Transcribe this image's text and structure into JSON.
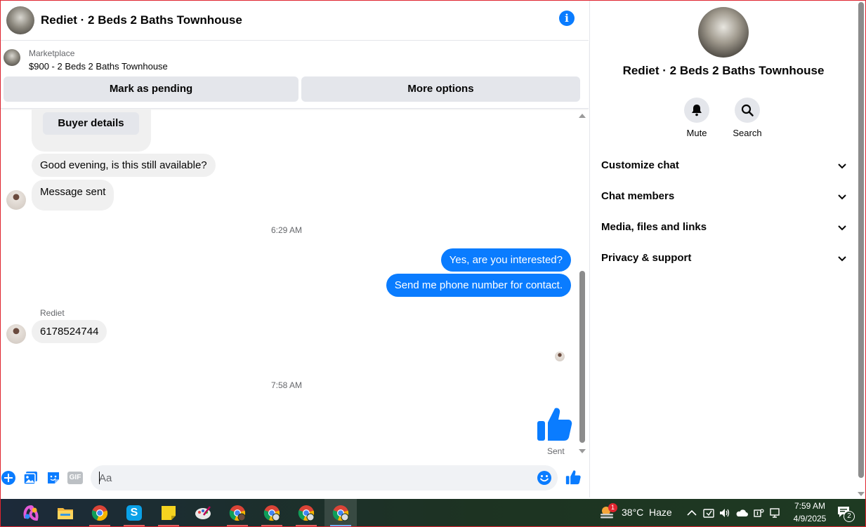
{
  "header": {
    "title": "Rediet · 2 Beds 2 Baths Townhouse"
  },
  "marketplace": {
    "label": "Marketplace",
    "listing": "$900 - 2 Beds 2 Baths Townhouse",
    "mark_pending_label": "Mark as pending",
    "more_options_label": "More options"
  },
  "messages": {
    "buyer_details_label": "Buyer details",
    "incoming_1": "Good evening, is this still available?",
    "incoming_2": "Message sent",
    "time_1": "6:29 AM",
    "outgoing_1": "Yes, are you interested?",
    "outgoing_2": "Send me phone number for contact.",
    "sender_name": "Rediet",
    "incoming_3": "6178524744",
    "time_2": "7:58 AM",
    "sent_status": "Sent"
  },
  "composer": {
    "placeholder": "Aa",
    "gif_label": "GIF"
  },
  "right_panel": {
    "title": "Rediet · 2 Beds 2 Baths Townhouse",
    "mute_label": "Mute",
    "search_label": "Search",
    "sections": [
      "Customize chat",
      "Chat members",
      "Media, files and links",
      "Privacy & support"
    ]
  },
  "taskbar": {
    "weather_temp": "38°C",
    "weather_desc": "Haze",
    "weather_badge": "1",
    "time": "7:59 AM",
    "date": "4/9/2025",
    "notification_count": "2"
  },
  "colors": {
    "messenger_blue": "#0a7cff",
    "bubble_gray": "#f0f0f0",
    "frame_red": "#e0242f"
  }
}
